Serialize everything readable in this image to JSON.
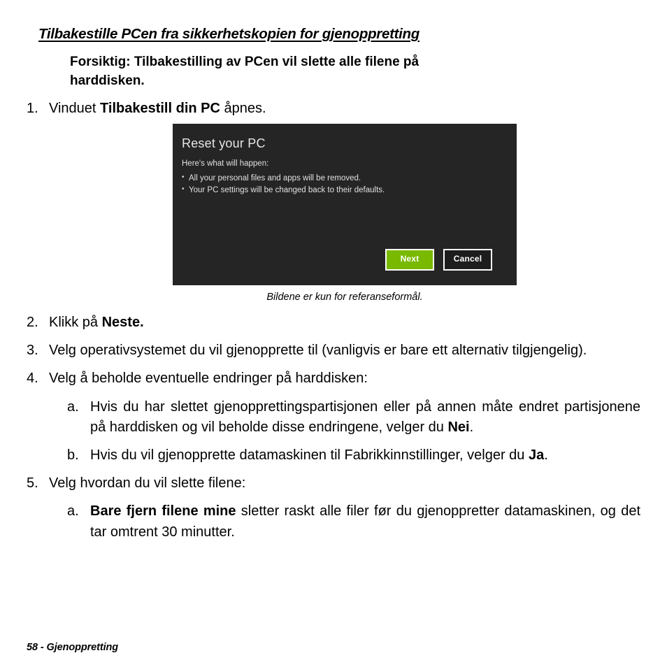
{
  "document": {
    "section_heading": "Tilbakestille PCen fra sikkerhetskopien for gjenoppretting",
    "caution": {
      "label": "Forsiktig:",
      "text": " Tilbakestilling av PCen vil slette alle filene på",
      "line2": "harddisken."
    },
    "footer": "58 - Gjenoppretting"
  },
  "steps": [
    {
      "marker": "1.",
      "text_before": "Vinduet ",
      "bold": "Tilbakestill din PC",
      "text_after": " åpnes."
    },
    {
      "marker": "2.",
      "text_before": "Klikk på ",
      "bold": "Neste.",
      "text_after": ""
    },
    {
      "marker": "3.",
      "text": "Velg operativsystemet du vil gjenopprette til (vanligvis er bare ett alternativ tilgjengelig)."
    },
    {
      "marker": "4.",
      "text": "Velg å beholde eventuelle endringer på harddisken:"
    },
    {
      "marker": "5.",
      "text": "Velg hvordan du vil slette filene:"
    }
  ],
  "substeps_group_a": [
    {
      "marker": "a.",
      "text_before": "Hvis du har slettet gjenopprettingspartisjonen eller på annen måte endret partisjonene på harddisken og vil beholde disse endringene, velger du ",
      "bold": "Nei",
      "text_after": "."
    },
    {
      "marker": "b.",
      "text_before": "Hvis du vil gjenopprette datamaskinen til Fabrikkinnstillinger, velger du ",
      "bold": "Ja",
      "text_after": "."
    }
  ],
  "substeps_group_b": [
    {
      "marker": "a.",
      "bold": "Bare fjern filene mine",
      "text_after": " sletter raskt alle filer før du gjenoppretter datamaskinen, og det tar omtrent 30 minutter."
    }
  ],
  "figure": {
    "caption": "Bildene er kun for referanseformål.",
    "screenshot": {
      "title": "Reset your PC",
      "subtitle": "Here's what will happen:",
      "bullets": [
        "All your personal files and apps will be removed.",
        "Your PC settings will be changed back to their defaults."
      ],
      "primary_button": "Next",
      "secondary_button": "Cancel",
      "colors": {
        "background": "#252526",
        "primary_button": "#79b900",
        "text": "#e0e0e0"
      }
    }
  }
}
